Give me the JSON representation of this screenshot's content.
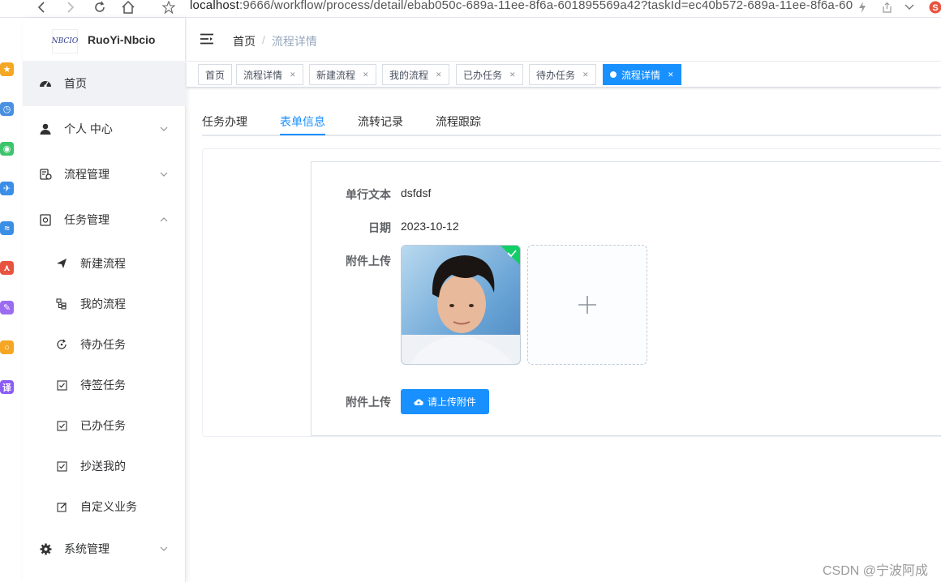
{
  "browser": {
    "url_host": "localhost",
    "url_rest": ":9666/workflow/process/detail/ebab050c-689a-11ee-8f6a-601895569a42?taskId=ec40b572-689a-11ee-8f6a-60"
  },
  "extensions": [
    {
      "icon": "star-app-icon",
      "color": "#f5a623",
      "glyph": "★"
    },
    {
      "icon": "clock-app-icon",
      "color": "#4a90e2",
      "glyph": "◷"
    },
    {
      "icon": "wechat-app-icon",
      "color": "#3dc46c",
      "glyph": "◉"
    },
    {
      "icon": "plane-app-icon",
      "color": "#3a8ee6",
      "glyph": "✈"
    },
    {
      "icon": "wave-app-icon",
      "color": "#3a8ee6",
      "glyph": "≈"
    },
    {
      "icon": "pdf-app-icon",
      "color": "#e8533f",
      "glyph": "⋏"
    },
    {
      "icon": "pen-app-icon",
      "color": "#9b6cf0",
      "glyph": "✎"
    },
    {
      "icon": "search-app-icon",
      "color": "#f5a623",
      "glyph": "○"
    },
    {
      "icon": "translate-app-icon",
      "color": "#8b5cf6",
      "glyph": "译"
    }
  ],
  "sidebar": {
    "logo_text": "NBCIO",
    "title": "RuoYi-Nbcio",
    "menu": [
      {
        "label": "首页",
        "icon": "dashboard-icon"
      },
      {
        "label": "个人 中心",
        "icon": "user-icon"
      },
      {
        "label": "流程管理",
        "icon": "process-icon"
      },
      {
        "label": "任务管理",
        "icon": "task-icon"
      }
    ],
    "submenu": [
      {
        "label": "新建流程",
        "icon": "send-icon"
      },
      {
        "label": "我的流程",
        "icon": "tree-icon"
      },
      {
        "label": "待办任务",
        "icon": "refresh-icon"
      },
      {
        "label": "待签任务",
        "icon": "checkbox-icon"
      },
      {
        "label": "已办任务",
        "icon": "checkbox-icon"
      },
      {
        "label": "抄送我的",
        "icon": "checkbox-icon"
      },
      {
        "label": "自定义业务",
        "icon": "edit-icon"
      }
    ],
    "system": {
      "label": "系统管理",
      "icon": "gear-icon"
    }
  },
  "header": {
    "breadcrumb_home": "首页",
    "breadcrumb_sep": "/",
    "breadcrumb_current": "流程详情"
  },
  "tags": [
    {
      "label": "首页"
    },
    {
      "label": "流程详情"
    },
    {
      "label": "新建流程"
    },
    {
      "label": "我的流程"
    },
    {
      "label": "已办任务"
    },
    {
      "label": "待办任务"
    },
    {
      "label": "流程详情"
    }
  ],
  "tabs": [
    "任务办理",
    "表单信息",
    "流转记录",
    "流程跟踪"
  ],
  "active_tab": 1,
  "form": {
    "text_label": "单行文本",
    "text_value": "dsfdsf",
    "date_label": "日期",
    "date_value": "2023-10-12",
    "image_upload_label": "附件上传",
    "file_upload_label": "附件上传",
    "upload_button": "请上传附件"
  },
  "watermark": "CSDN @宁波阿成",
  "colors": {
    "primary": "#1890ff",
    "success": "#13ce66"
  }
}
